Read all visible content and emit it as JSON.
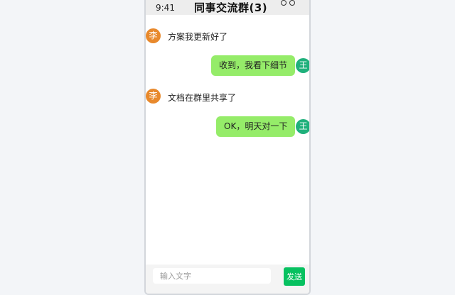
{
  "status_bar": {
    "time": "9:41"
  },
  "header": {
    "title": "同事交流群(3)"
  },
  "messages": [
    {
      "sender": "other",
      "avatar": "李",
      "text": "方案我更新好了"
    },
    {
      "sender": "me",
      "avatar": "王",
      "text": "收到，我看下细节"
    },
    {
      "sender": "other",
      "avatar": "李",
      "text": "文档在群里共享了"
    },
    {
      "sender": "me",
      "avatar": "王",
      "text": "OK，明天对一下"
    }
  ],
  "composer": {
    "placeholder": "输入文字",
    "send_label": "发送"
  },
  "colors": {
    "bubble_me": "#95ec69",
    "avatar_li": "#e8892c",
    "avatar_wang": "#1fb07b",
    "send_button": "#07c160"
  },
  "icons": [
    "more-icon"
  ]
}
